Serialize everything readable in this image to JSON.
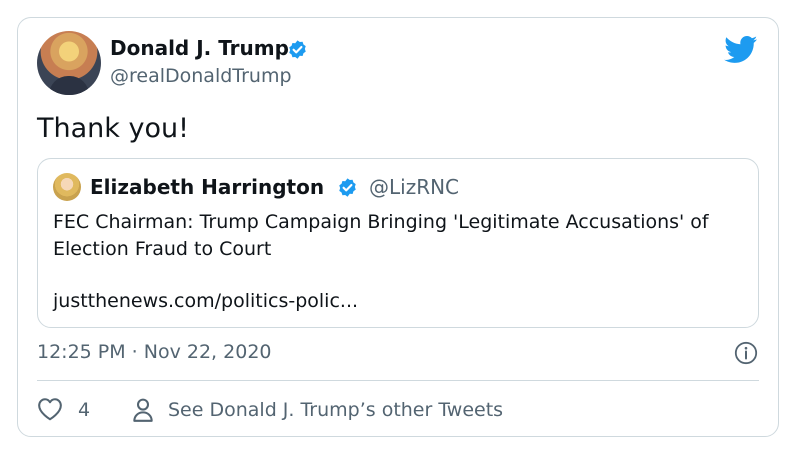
{
  "tweet": {
    "author_name": "Donald J. Trump",
    "author_handle": "@realDonaldTrump",
    "text": "Thank you!",
    "timestamp": "12:25 PM · Nov 22, 2020",
    "like_count": "4",
    "other_tweets_label": "See Donald J. Trump’s other Tweets"
  },
  "quoted": {
    "author_name": "Elizabeth Harrington",
    "author_handle": "@LizRNC",
    "text": "FEC Chairman: Trump Campaign Bringing 'Legitimate Accusations' of Election Fraud to Court",
    "link": "justthenews.com/politics-polic..."
  },
  "icons": [
    "verified-badge-icon",
    "twitter-bird-icon",
    "info-icon",
    "heart-icon",
    "person-icon"
  ],
  "colors": {
    "accent": "#1d9bf0",
    "text": "#0f1419",
    "secondary": "#536471",
    "border": "#cfd9de"
  }
}
